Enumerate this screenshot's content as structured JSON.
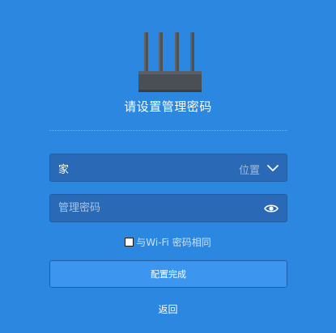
{
  "header": {
    "title": "请设置管理密码",
    "icon": "router-icon"
  },
  "location_select": {
    "value": "家",
    "placeholder": "位置",
    "icon": "chevron-down-icon"
  },
  "password_field": {
    "placeholder": "管理密码",
    "value": "",
    "icon": "eye-icon"
  },
  "same_as_wifi": {
    "label": "与Wi-Fi 密码相同",
    "checked": false
  },
  "finish_button": {
    "label": "配置完成"
  },
  "back_link": {
    "label": "返回"
  },
  "colors": {
    "background": "#2b87e0",
    "field_background": "#2a69b5",
    "button_background": "#3c96f0",
    "router_body": "#4a4f55"
  }
}
